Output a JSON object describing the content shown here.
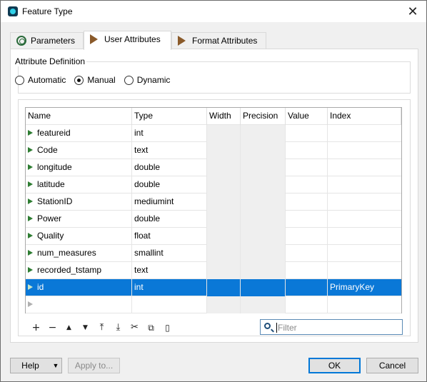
{
  "window": {
    "title": "Feature Type",
    "close_glyph": "✕",
    "icon": "fme-app-icon"
  },
  "tabs": [
    {
      "label": "Parameters",
      "icon": "gear-icon"
    },
    {
      "label": "User Attributes",
      "icon": "tag-arrow-icon"
    },
    {
      "label": "Format Attributes",
      "icon": "tag-arrow-icon"
    }
  ],
  "attribute_definition": {
    "label": "Attribute Definition",
    "options": [
      "Automatic",
      "Manual",
      "Dynamic"
    ],
    "selected": "Manual"
  },
  "table": {
    "columns": [
      "Name",
      "Type",
      "Width",
      "Precision",
      "Value",
      "Index"
    ],
    "rows": [
      {
        "name": "featureid",
        "type": "int",
        "width": "",
        "precision": "",
        "value": "",
        "index": ""
      },
      {
        "name": "Code",
        "type": "text",
        "width": "",
        "precision": "",
        "value": "",
        "index": ""
      },
      {
        "name": "longitude",
        "type": "double",
        "width": "",
        "precision": "",
        "value": "",
        "index": ""
      },
      {
        "name": "latitude",
        "type": "double",
        "width": "",
        "precision": "",
        "value": "",
        "index": ""
      },
      {
        "name": "StationID",
        "type": "mediumint",
        "width": "",
        "precision": "",
        "value": "",
        "index": ""
      },
      {
        "name": "Power",
        "type": "double",
        "width": "",
        "precision": "",
        "value": "",
        "index": ""
      },
      {
        "name": "Quality",
        "type": "float",
        "width": "",
        "precision": "",
        "value": "",
        "index": ""
      },
      {
        "name": "num_measures",
        "type": "smallint",
        "width": "",
        "precision": "",
        "value": "",
        "index": ""
      },
      {
        "name": "recorded_tstamp",
        "type": "text",
        "width": "",
        "precision": "",
        "value": "",
        "index": ""
      },
      {
        "name": "id",
        "type": "int",
        "width": "",
        "precision": "",
        "value": "",
        "index": "PrimaryKey"
      }
    ],
    "selected_row": 9
  },
  "toolbar": {
    "add": "+",
    "remove": "−",
    "move_up": "▲",
    "move_down": "▼",
    "move_top": "⤒",
    "move_bottom": "⤓",
    "cut": "✂",
    "copy": "⧉",
    "paste": "▯"
  },
  "filter": {
    "placeholder": "Filter",
    "value": ""
  },
  "buttons": {
    "help": "Help",
    "help_dropdown": "▼",
    "apply_to": "Apply to...",
    "ok": "OK",
    "cancel": "Cancel"
  },
  "colors": {
    "selection": "#0a78d7",
    "triangle": "#2e7d32"
  }
}
